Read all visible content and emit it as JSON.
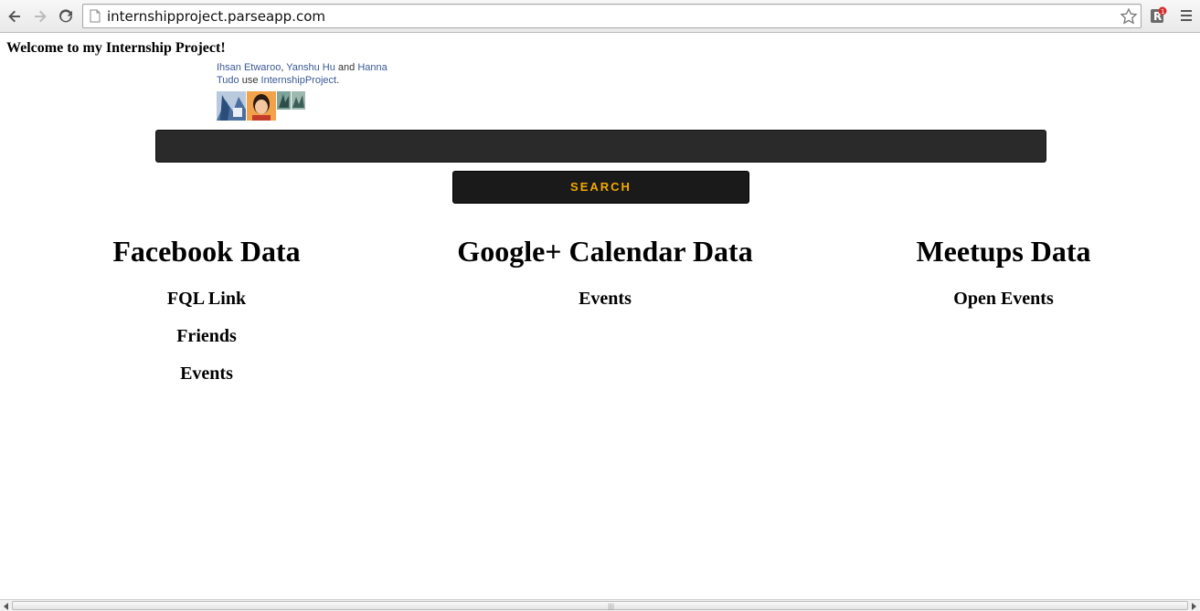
{
  "browser": {
    "url": "internshipproject.parseapp.com",
    "extension_badge": "1"
  },
  "page": {
    "welcome": "Welcome to my Internship Project!",
    "social": {
      "friend1": "Ihsan Etwaroo",
      "sep1": ", ",
      "friend2": "Yanshu Hu",
      "and": " and ",
      "friend3": "Hanna Tudo",
      "use": " use ",
      "app_name": "InternshipProject",
      "period": "."
    },
    "search": {
      "value": "",
      "button_label": "SEARCH"
    },
    "columns": [
      {
        "title": "Facebook Data",
        "links": [
          "FQL Link",
          "Friends",
          "Events"
        ]
      },
      {
        "title": "Google+ Calendar Data",
        "links": [
          "Events"
        ]
      },
      {
        "title": "Meetups Data",
        "links": [
          "Open Events"
        ]
      }
    ]
  },
  "colors": {
    "search_button_text": "#f2a900",
    "search_bg": "#2a2a2a",
    "link": "#3b5998"
  }
}
